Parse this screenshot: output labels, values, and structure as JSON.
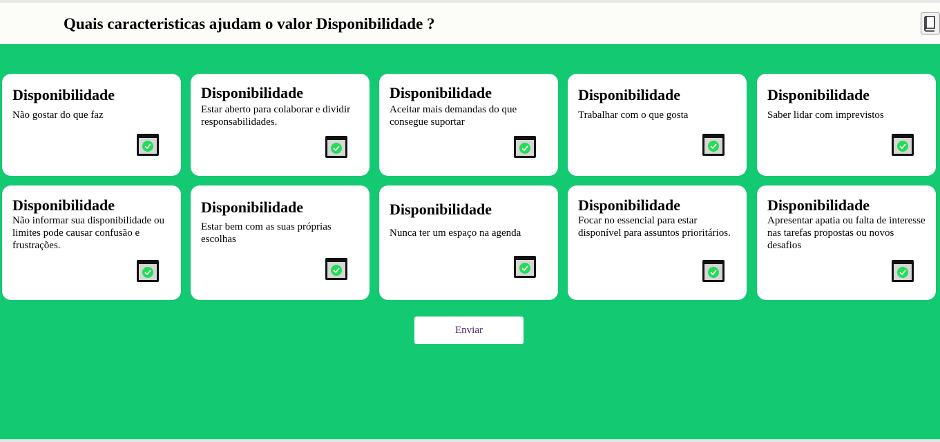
{
  "header": {
    "title": "Quais caracteristicas ajudam o valor Disponibilidade ?",
    "book_icon": "book-icon"
  },
  "cards": [
    {
      "title": "Disponibilidade",
      "text": "Não gostar do que faz"
    },
    {
      "title": "Disponibilidade",
      "text": "Estar aberto para colaborar e dividir responsabilidades."
    },
    {
      "title": "Disponibilidade",
      "text": "Aceitar mais demandas do que consegue suportar"
    },
    {
      "title": "Disponibilidade",
      "text": "Trabalhar com o que gosta"
    },
    {
      "title": "Disponibilidade",
      "text": "Saber lidar com imprevistos"
    },
    {
      "title": "Disponibilidade",
      "text": "Não informar sua disponibilidade ou limites pode causar confusão e frustrações."
    },
    {
      "title": "Disponibilidade",
      "text": "Estar bem com as suas próprias escolhas"
    },
    {
      "title": "Disponibilidade",
      "text": "Nunca ter um espaço na agenda"
    },
    {
      "title": "Disponibilidade",
      "text": "Focar no essencial para estar disponível para assuntos prioritários."
    },
    {
      "title": "Disponibilidade",
      "text": "Apresentar apatia ou falta de interesse nas tarefas propostas ou novos desafios"
    }
  ],
  "send_label": "Enviar",
  "colors": {
    "background": "#13c972",
    "card": "#ffffff",
    "check": "#22dd55"
  }
}
